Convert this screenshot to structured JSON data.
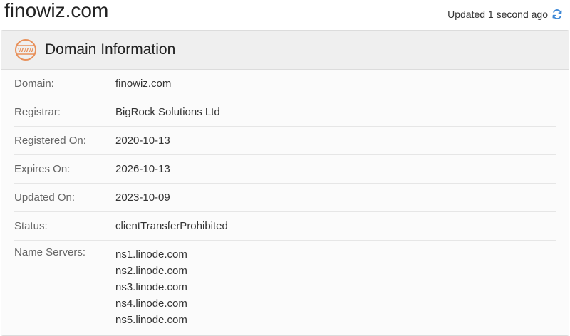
{
  "header": {
    "site_title": "finowiz.com",
    "updated_text": "Updated 1 second ago",
    "refresh_icon": "refresh-icon"
  },
  "panel": {
    "icon": "www-icon",
    "icon_text": "www",
    "title": "Domain Information",
    "rows": [
      {
        "label": "Domain:",
        "value": "finowiz.com"
      },
      {
        "label": "Registrar:",
        "value": "BigRock Solutions Ltd"
      },
      {
        "label": "Registered On:",
        "value": "2020-10-13"
      },
      {
        "label": "Expires On:",
        "value": "2026-10-13"
      },
      {
        "label": "Updated On:",
        "value": "2023-10-09"
      },
      {
        "label": "Status:",
        "value": "clientTransferProhibited"
      }
    ],
    "name_servers_label": "Name Servers:",
    "name_servers": [
      "ns1.linode.com",
      "ns2.linode.com",
      "ns3.linode.com",
      "ns4.linode.com",
      "ns5.linode.com"
    ]
  },
  "colors": {
    "accent_orange": "#e8905a",
    "refresh_blue": "#3a86d6",
    "header_bg": "#efefef"
  }
}
